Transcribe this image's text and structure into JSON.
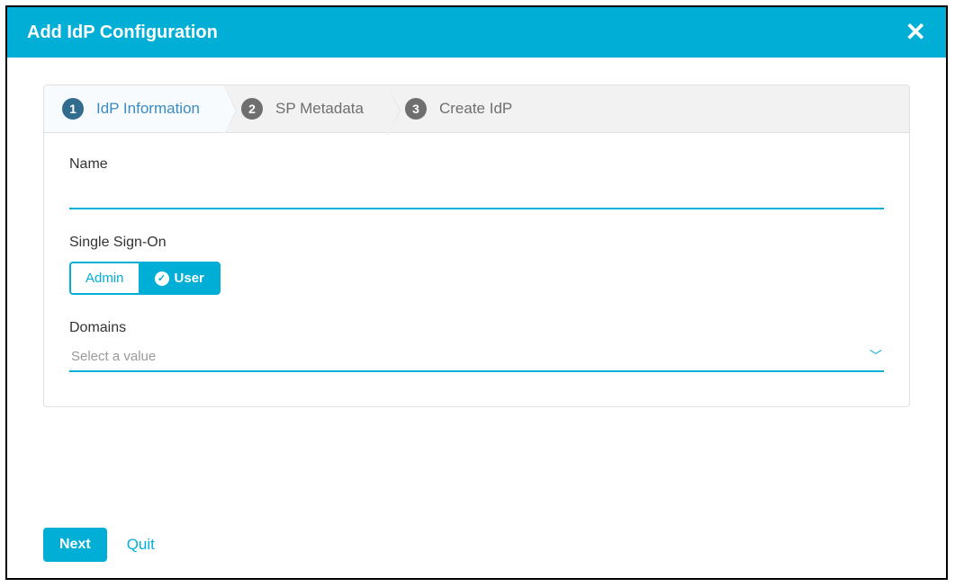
{
  "modal": {
    "title": "Add IdP Configuration"
  },
  "wizard": {
    "steps": [
      {
        "num": "1",
        "label": "IdP Information",
        "active": true
      },
      {
        "num": "2",
        "label": "SP Metadata",
        "active": false
      },
      {
        "num": "3",
        "label": "Create IdP",
        "active": false
      }
    ]
  },
  "form": {
    "name": {
      "label": "Name",
      "value": ""
    },
    "sso": {
      "label": "Single Sign-On",
      "options": [
        {
          "label": "Admin",
          "selected": false
        },
        {
          "label": "User",
          "selected": true
        }
      ]
    },
    "domains": {
      "label": "Domains",
      "placeholder": "Select a value"
    }
  },
  "footer": {
    "next": "Next",
    "quit": "Quit"
  }
}
